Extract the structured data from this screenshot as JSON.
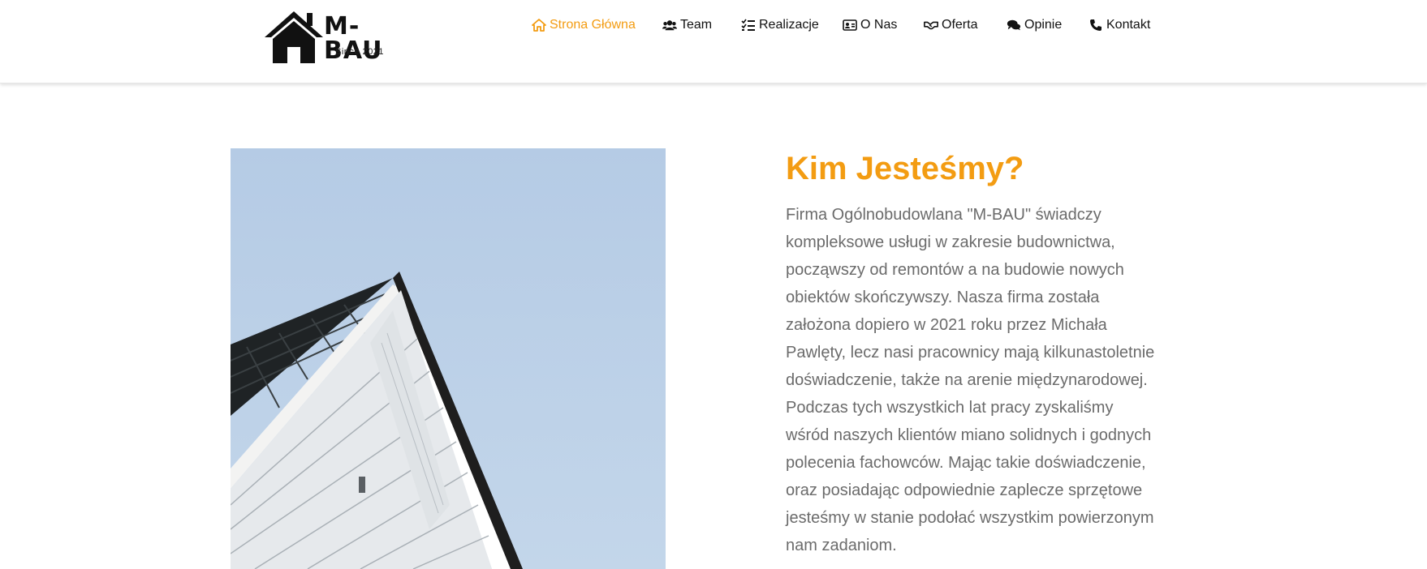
{
  "brand": {
    "name": "M-BAU",
    "since": "Since 2021"
  },
  "nav": {
    "items": [
      {
        "label": "Strona Główna",
        "icon": "home-icon",
        "active": true
      },
      {
        "label": "Team",
        "icon": "users-icon",
        "active": false
      },
      {
        "label": "Realizacje",
        "icon": "tasks-icon",
        "active": false
      },
      {
        "label": "O Nas",
        "icon": "id-card-icon",
        "active": false
      },
      {
        "label": "Oferta",
        "icon": "handshake-icon",
        "active": false
      },
      {
        "label": "Opinie",
        "icon": "comments-icon",
        "active": false
      },
      {
        "label": "Kontakt",
        "icon": "phone-icon",
        "active": false
      }
    ]
  },
  "about": {
    "heading": "Kim Jesteśmy?",
    "paragraph": "Firma Ogólnobudowlana \"M-BAU\" świadczy kompleksowe usługi w zakresie budownictwa, począwszy od remontów a na budowie nowych obiektów skończywszy. Nasza firma została założona dopiero w 2021 roku przez Michała Pawlęty, lecz nasi pracownicy mają kilkunastoletnie doświadczenie, także na arenie międzynarodowej. Podczas tych wszystkich lat pracy zyskaliśmy wśród naszych klientów miano solidnych i godnych polecenia fachowców. Mając takie doświadczenie, oraz posiadając odpowiednie zaplecze sprzętowe jesteśmy w stanie podołać wszystkim powierzonym nam zadaniom."
  },
  "colors": {
    "accent": "#f39c12",
    "text": "#6b6b6b",
    "nav_text": "#111111",
    "sky": "#b9cfe6"
  }
}
